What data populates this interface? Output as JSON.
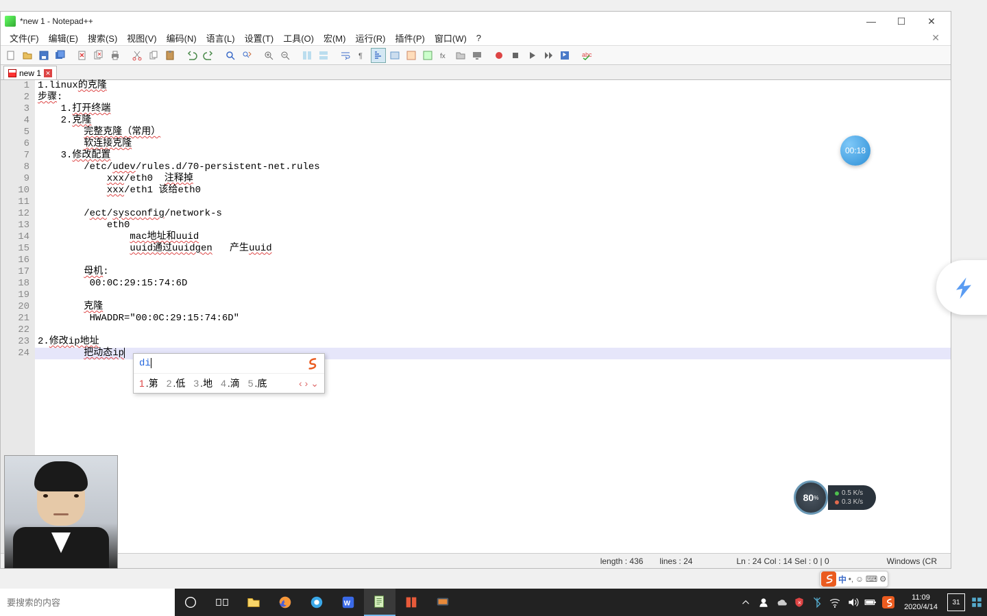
{
  "title": "*new 1 - Notepad++",
  "menu": [
    "文件(F)",
    "编辑(E)",
    "搜索(S)",
    "视图(V)",
    "编码(N)",
    "语言(L)",
    "设置(T)",
    "工具(O)",
    "宏(M)",
    "运行(R)",
    "插件(P)",
    "窗口(W)",
    "?"
  ],
  "tab": {
    "label": "new 1"
  },
  "lines": [
    {
      "n": "1",
      "segs": [
        {
          "t": "1.linux"
        },
        {
          "t": "的克隆",
          "u": true
        }
      ]
    },
    {
      "n": "2",
      "segs": [
        {
          "t": "步骤",
          "u": true
        },
        {
          "t": ":"
        }
      ]
    },
    {
      "n": "3",
      "segs": [
        {
          "t": "    1."
        },
        {
          "t": "打开终端",
          "u": true
        }
      ]
    },
    {
      "n": "4",
      "segs": [
        {
          "t": "    2."
        },
        {
          "t": "克隆",
          "u": true
        }
      ]
    },
    {
      "n": "5",
      "segs": [
        {
          "t": "        "
        },
        {
          "t": "完整克隆（常用）",
          "u": true
        }
      ]
    },
    {
      "n": "6",
      "segs": [
        {
          "t": "        "
        },
        {
          "t": "软连接克隆",
          "u": true
        }
      ]
    },
    {
      "n": "7",
      "segs": [
        {
          "t": "    3."
        },
        {
          "t": "修改配置",
          "u": true
        }
      ]
    },
    {
      "n": "8",
      "segs": [
        {
          "t": "        /etc/"
        },
        {
          "t": "udev",
          "u": true
        },
        {
          "t": "/rules.d/70-persistent-net.rules"
        }
      ]
    },
    {
      "n": "9",
      "segs": [
        {
          "t": "            "
        },
        {
          "t": "xxx",
          "u": true
        },
        {
          "t": "/eth0  "
        },
        {
          "t": "注释掉",
          "u": true
        }
      ]
    },
    {
      "n": "10",
      "segs": [
        {
          "t": "            "
        },
        {
          "t": "xxx",
          "u": true
        },
        {
          "t": "/eth1 该给eth0"
        }
      ]
    },
    {
      "n": "11",
      "segs": [
        {
          "t": ""
        }
      ]
    },
    {
      "n": "12",
      "segs": [
        {
          "t": "        /"
        },
        {
          "t": "ect",
          "u": true
        },
        {
          "t": "/"
        },
        {
          "t": "sysconfig",
          "u": true
        },
        {
          "t": "/network-s"
        }
      ]
    },
    {
      "n": "13",
      "segs": [
        {
          "t": "            eth0"
        }
      ]
    },
    {
      "n": "14",
      "segs": [
        {
          "t": "                "
        },
        {
          "t": "mac地址和uuid",
          "u": true
        }
      ]
    },
    {
      "n": "15",
      "segs": [
        {
          "t": "                "
        },
        {
          "t": "uuid通过uuidgen",
          "u": true
        },
        {
          "t": "   产生"
        },
        {
          "t": "uuid",
          "u": true
        }
      ]
    },
    {
      "n": "16",
      "segs": [
        {
          "t": ""
        }
      ]
    },
    {
      "n": "17",
      "segs": [
        {
          "t": "        "
        },
        {
          "t": "母机",
          "u": true
        },
        {
          "t": ":"
        }
      ]
    },
    {
      "n": "18",
      "segs": [
        {
          "t": "         00:0C:29:15:74:6D"
        }
      ]
    },
    {
      "n": "19",
      "segs": [
        {
          "t": ""
        }
      ]
    },
    {
      "n": "20",
      "segs": [
        {
          "t": "        "
        },
        {
          "t": "克隆",
          "u": true
        }
      ]
    },
    {
      "n": "21",
      "segs": [
        {
          "t": "         HWADDR=\"00:0C:29:15:74:6D\""
        }
      ]
    },
    {
      "n": "22",
      "segs": [
        {
          "t": ""
        }
      ]
    },
    {
      "n": "23",
      "segs": [
        {
          "t": "2."
        },
        {
          "t": "修改ip地址",
          "u": true
        }
      ]
    },
    {
      "n": "24",
      "hl": true,
      "segs": [
        {
          "t": "        "
        },
        {
          "t": "把动态ip",
          "u": true
        }
      ],
      "caret": true
    }
  ],
  "status": {
    "length": "length : 436",
    "lines": "lines : 24",
    "pos": "Ln : 24    Col : 14    Sel : 0 | 0",
    "enc": "Windows (CR"
  },
  "ime": {
    "input": "di",
    "candidates": [
      {
        "n": "1",
        "c": "第"
      },
      {
        "n": "2",
        "c": "低"
      },
      {
        "n": "3",
        "c": "地"
      },
      {
        "n": "4",
        "c": "滴"
      },
      {
        "n": "5",
        "c": "底"
      }
    ]
  },
  "timer": "00:18",
  "monitor": {
    "pct": "80",
    "unit": "%",
    "up": "0.5 K/s",
    "down": "0.3 K/s"
  },
  "taskbar": {
    "search_placeholder": "要搜索的内容"
  },
  "clock": {
    "time": "11:09",
    "date": "2020/4/14",
    "notif": "31"
  },
  "imetb": {
    "lang": "中"
  }
}
